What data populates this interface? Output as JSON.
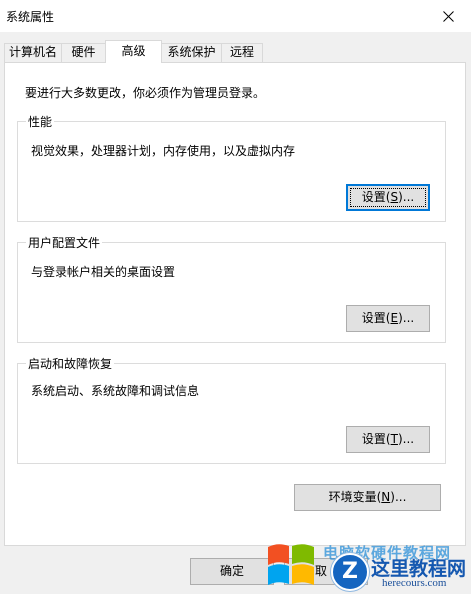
{
  "window": {
    "title": "系统属性"
  },
  "tabs": [
    {
      "label": "计算机名"
    },
    {
      "label": "硬件"
    },
    {
      "label": "高级"
    },
    {
      "label": "系统保护"
    },
    {
      "label": "远程"
    }
  ],
  "active_tab": "高级",
  "advanced": {
    "admin_note": "要进行大多数更改，你必须作为管理员登录。",
    "performance": {
      "legend": "性能",
      "description": "视觉效果，处理器计划，内存使用，以及虚拟内存",
      "button_label": "设置",
      "button_mnemonic": "S",
      "button_ellipsis": "..."
    },
    "user_profiles": {
      "legend": "用户配置文件",
      "description": "与登录帐户相关的桌面设置",
      "button_label": "设置",
      "button_mnemonic": "E",
      "button_ellipsis": "..."
    },
    "startup_recovery": {
      "legend": "启动和故障恢复",
      "description": "系统启动、系统故障和调试信息",
      "button_label": "设置",
      "button_mnemonic": "T",
      "button_ellipsis": "..."
    },
    "env_vars": {
      "button_label": "环境变量",
      "button_mnemonic": "N",
      "button_ellipsis": "..."
    }
  },
  "footer": {
    "ok_label": "确定",
    "cancel_label_visible": "取"
  },
  "watermark": {
    "top_text": "电脑软硬件教程网",
    "badge_letter": "Z",
    "site_name": "这里教程网",
    "domain": "herecours.com"
  },
  "colors": {
    "accent": "#0078d7",
    "panel_bg": "#ffffff",
    "window_bg": "#f0f0f0",
    "button_bg": "#e1e1e1"
  },
  "icons": {
    "close": "close-icon",
    "windows_logo": "windows-logo-icon"
  }
}
